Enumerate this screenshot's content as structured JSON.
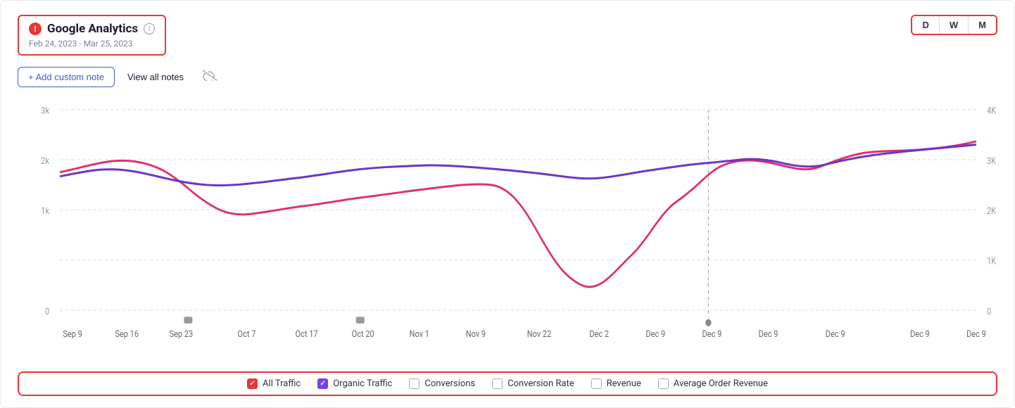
{
  "header": {
    "title": "Google Analytics",
    "date_range": "Feb 24, 2023 - Mar 25, 2023",
    "warning_icon_label": "!"
  },
  "toolbar": {
    "add_note_label": "+ Add custom note",
    "view_notes_label": "View all notes",
    "eye_icon": "👁"
  },
  "period_selector": {
    "options": [
      "D",
      "W",
      "M"
    ]
  },
  "chart": {
    "x_labels": [
      "Sep 9",
      "Sep 16",
      "Sep 23",
      "Oct 7",
      "Oct 17",
      "Oct 20",
      "Nov 1",
      "Nov 9",
      "Nov 22",
      "Dec 2",
      "Dec 9",
      "Dec 9",
      "Dec 9",
      "Dec 9",
      "Dec 9"
    ],
    "y_left_labels": [
      "3k",
      "2k",
      "1k",
      "0"
    ],
    "y_right_labels": [
      "4K",
      "3K",
      "2K",
      "1K",
      "0"
    ]
  },
  "legend": {
    "items": [
      {
        "label": "All Traffic",
        "checked": true,
        "color": "red"
      },
      {
        "label": "Organic Traffic",
        "checked": true,
        "color": "purple"
      },
      {
        "label": "Conversions",
        "checked": false,
        "color": "none"
      },
      {
        "label": "Conversion Rate",
        "checked": false,
        "color": "none"
      },
      {
        "label": "Revenue",
        "checked": false,
        "color": "none"
      },
      {
        "label": "Average Order Revenue",
        "checked": false,
        "color": "none"
      }
    ]
  }
}
